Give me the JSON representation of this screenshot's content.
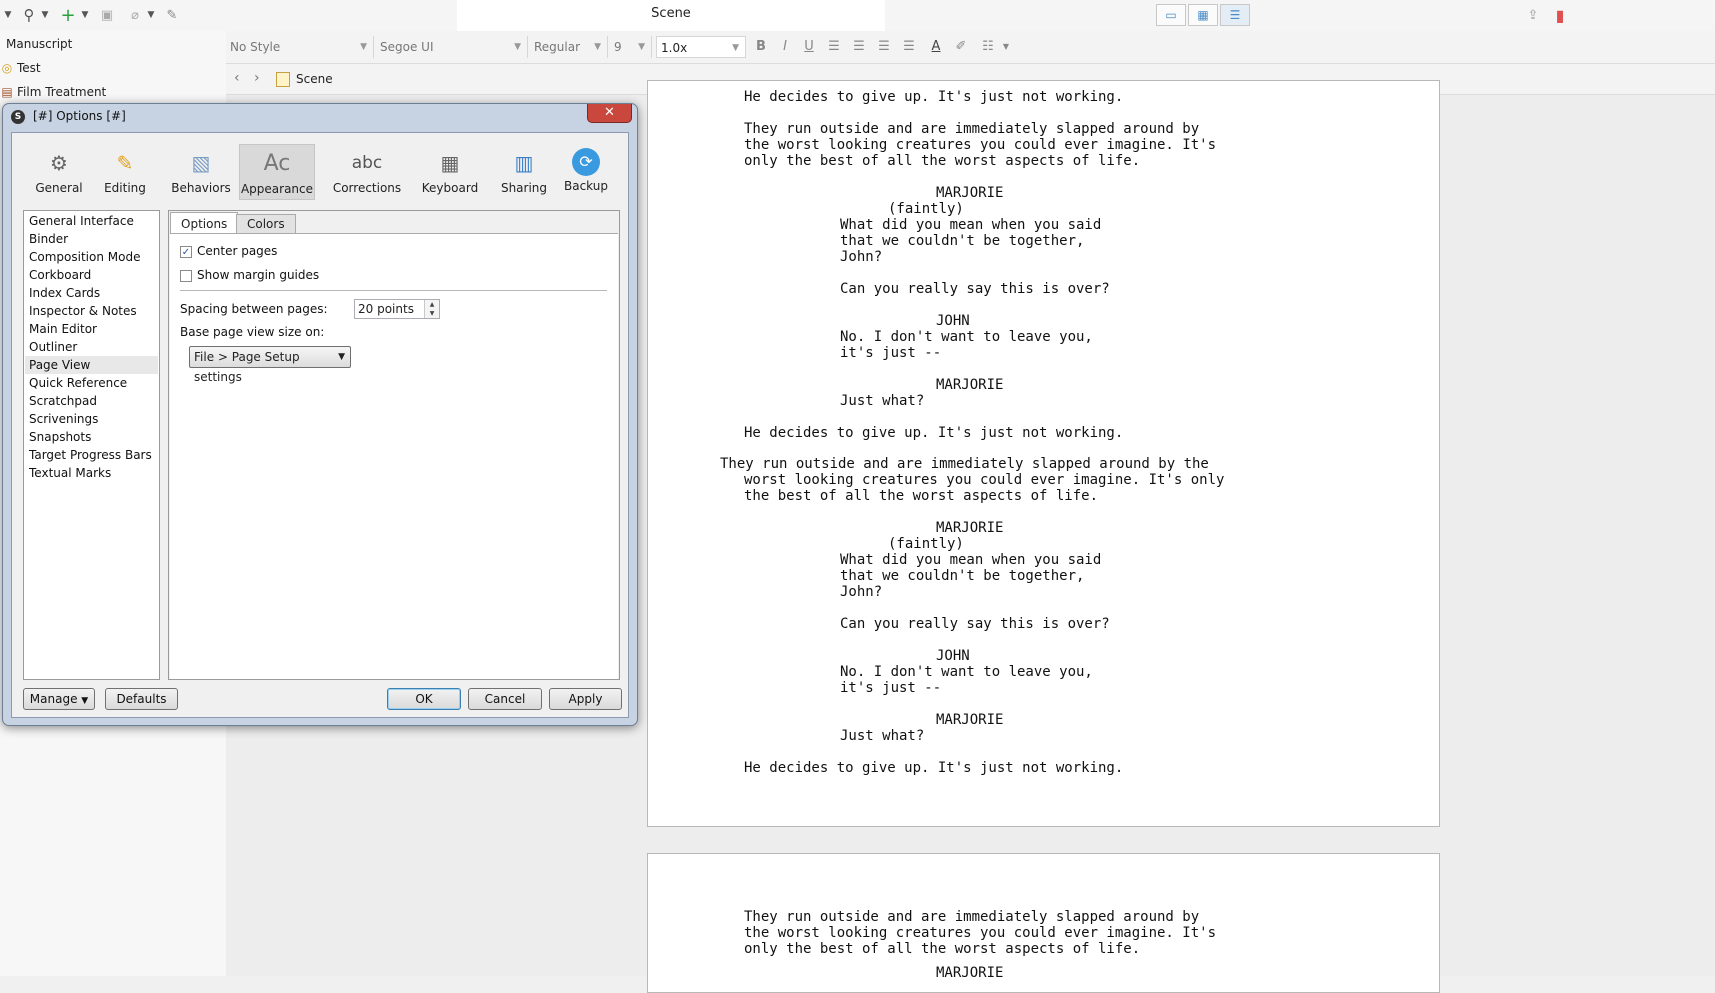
{
  "window": {
    "title": "Scene",
    "colors": {
      "accent": "#4a8cc7",
      "bookmark": "#e05050",
      "dialog_frame": "#c7d3e2"
    }
  },
  "toolbar": {
    "icons": [
      "chevron-down-icon",
      "search-icon",
      "add-icon",
      "trash-icon",
      "clip-icon",
      "compose-icon"
    ],
    "view_modes": [
      "single-page-icon",
      "grid-icon",
      "outline-icon"
    ],
    "right_icons": [
      "share-icon",
      "bookmark-icon"
    ]
  },
  "binder": {
    "items": [
      {
        "label": "Manuscript",
        "icon": ""
      },
      {
        "label": "Test",
        "icon": "lightbulb-icon"
      },
      {
        "label": "Film Treatment",
        "icon": "book-icon"
      }
    ]
  },
  "format_bar": {
    "style": "No Style",
    "font": "Segoe UI",
    "weight": "Regular",
    "size": "9",
    "line_spacing": "1.0x"
  },
  "nav": {
    "breadcrumb": "Scene"
  },
  "script": {
    "page1": [
      "He decides to give up. It's just not working.",
      "They run outside and are immediately slapped around by",
      "the worst looking creatures you could ever imagine. It's",
      "only the best of all the worst aspects of life.",
      "MARJORIE",
      "(faintly)",
      "What did you mean when you said",
      "that we couldn't be together,",
      "John?",
      "Can you really say this is over?",
      "JOHN",
      "No. I don't want to leave you,",
      "it's just --",
      "MARJORIE",
      "Just what?",
      "He decides to give up. It's just not working.",
      "They run outside and are immediately slapped around by the",
      "worst looking creatures you could ever imagine. It's only",
      "the best of all the worst aspects of life.",
      "MARJORIE",
      "(faintly)",
      "What did you mean when you said",
      "that we couldn't be together,",
      "John?",
      "Can you really say this is over?",
      "JOHN",
      "No. I don't want to leave you,",
      "it's just --",
      "MARJORIE",
      "Just what?",
      "He decides to give up. It's just not working."
    ],
    "page2": [
      "They run outside and are immediately slapped around by",
      "the worst looking creatures you could ever imagine. It's",
      "only the best of all the worst aspects of life.",
      "MARJORIE"
    ]
  },
  "dialog": {
    "title": "[#] Options [#]",
    "close_glyph": "✕",
    "categories": [
      {
        "label": "General",
        "icon": "gears-icon"
      },
      {
        "label": "Editing",
        "icon": "pencil-icon"
      },
      {
        "label": "Behaviors",
        "icon": "behaviors-icon"
      },
      {
        "label": "Appearance",
        "icon": "appearance-icon"
      },
      {
        "label": "Corrections",
        "icon": "abc-icon"
      },
      {
        "label": "Keyboard",
        "icon": "keyboard-icon"
      },
      {
        "label": "Sharing",
        "icon": "sharing-icon"
      },
      {
        "label": "Backup",
        "icon": "backup-icon"
      }
    ],
    "active_category": "Appearance",
    "abc_glyph": "abc",
    "appearance_glyph": "Ac",
    "subcategories": [
      "General Interface",
      "Binder",
      "Composition Mode",
      "Corkboard",
      "Index Cards",
      "Inspector & Notes",
      "Main Editor",
      "Outliner",
      "Page View",
      "Quick Reference",
      "Scratchpad",
      "Scrivenings",
      "Snapshots",
      "Target Progress Bars",
      "Textual Marks"
    ],
    "selected_subcategory": "Page View",
    "tabs": [
      "Options",
      "Colors"
    ],
    "options": {
      "center_pages": {
        "label": "Center pages",
        "checked": true
      },
      "show_margin_guides": {
        "label": "Show margin guides",
        "checked": false
      },
      "spacing_label": "Spacing between pages:",
      "spacing_value": "20 points",
      "base_label": "Base page view size on:",
      "base_value": "File > Page Setup settings"
    },
    "buttons": {
      "manage": "Manage",
      "defaults": "Defaults",
      "ok": "OK",
      "cancel": "Cancel",
      "apply": "Apply"
    }
  }
}
